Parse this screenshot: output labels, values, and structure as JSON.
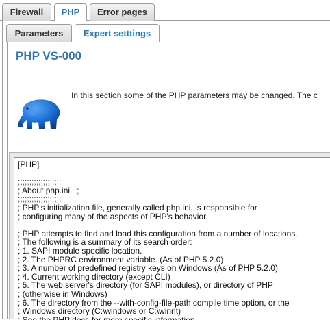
{
  "top_tabs": {
    "firewall": "Firewall",
    "php": "PHP",
    "error_pages": "Error pages"
  },
  "sub_tabs": {
    "parameters": "Parameters",
    "expert_settings": "Expert setttings"
  },
  "page": {
    "title": "PHP VS-000",
    "intro": "In this section some of the PHP parameters may be changed. The c",
    "logo_icon": "php-elephant-icon"
  },
  "colors": {
    "accent": "#2a76bb",
    "elephant": "#1c6fd6",
    "border": "#9c9c9c"
  },
  "php_ini": {
    "content": "[PHP]\n\n;;;;;;;;;;;;;;;;;;;\n; About php.ini   ;\n;;;;;;;;;;;;;;;;;;;\n; PHP's initialization file, generally called php.ini, is responsible for\n; configuring many of the aspects of PHP's behavior.\n\n; PHP attempts to find and load this configuration from a number of locations.\n; The following is a summary of its search order:\n; 1. SAPI module specific location.\n; 2. The PHPRC environment variable. (As of PHP 5.2.0)\n; 3. A number of predefined registry keys on Windows (As of PHP 5.2.0)\n; 4. Current working directory (except CLI)\n; 5. The web server's directory (for SAPI modules), or directory of PHP\n; (otherwise in Windows)\n; 6. The directory from the --with-config-file-path compile time option, or the\n; Windows directory (C:\\windows or C:\\winnt)\n; See the PHP docs for more specific information.\n; http://www.php.net/manual/en/configuration.file.php"
  }
}
